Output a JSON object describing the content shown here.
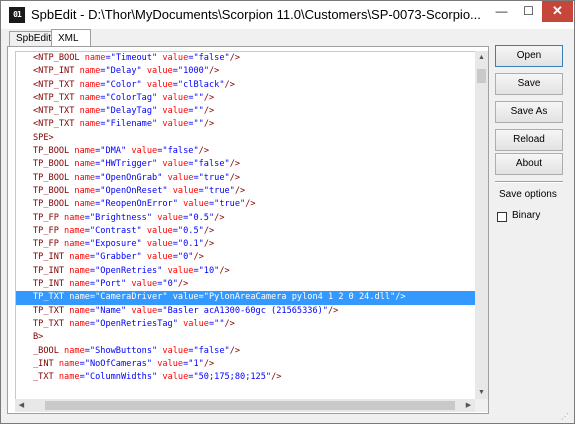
{
  "window": {
    "title": "SpbEdit - D:\\Thor\\MyDocuments\\Scorpion 11.0\\Customers\\SP-0073-Scorpio...",
    "icon_text": "01",
    "minimize_glyph": "—",
    "maximize_glyph": "☐",
    "close_glyph": "✕"
  },
  "tabs": [
    "SpbEdit",
    "XML"
  ],
  "editor": {
    "selected_line": 20,
    "lines": [
      {
        "tag": "<NTP_BOOL",
        "name": "Timeout",
        "value": "false",
        "end": "/>"
      },
      {
        "tag": "<NTP_INT",
        "name": "Delay",
        "value": "1000",
        "end": "/>"
      },
      {
        "tag": "<NTP_TXT",
        "name": "Color",
        "value": "clBlack",
        "end": "/>"
      },
      {
        "tag": "<NTP_TXT",
        "name": "ColorTag",
        "value": "",
        "end": "/>"
      },
      {
        "tag": "<NTP_TXT",
        "name": "DelayTag",
        "value": "",
        "end": "/>"
      },
      {
        "tag": "<NTP_TXT",
        "name": "Filename",
        "value": "",
        "end": "/>"
      },
      {
        "tag": "SPE>",
        "name": null,
        "value": null,
        "end": ""
      },
      {
        "tag": "TP_BOOL",
        "name": "DMA",
        "value": "false",
        "end": "/>"
      },
      {
        "tag": "TP_BOOL",
        "name": "HWTrigger",
        "value": "false",
        "end": "/>"
      },
      {
        "tag": "TP_BOOL",
        "name": "OpenOnGrab",
        "value": "true",
        "end": "/>"
      },
      {
        "tag": "TP_BOOL",
        "name": "OpenOnReset",
        "value": "true",
        "end": "/>"
      },
      {
        "tag": "TP_BOOL",
        "name": "ReopenOnError",
        "value": "true",
        "end": "/>"
      },
      {
        "tag": "TP_FP",
        "name": "Brightness",
        "value": "0.5",
        "end": "/>"
      },
      {
        "tag": "TP_FP",
        "name": "Contrast",
        "value": "0.5",
        "end": "/>"
      },
      {
        "tag": "TP_FP",
        "name": "Exposure",
        "value": "0.1",
        "end": "/>"
      },
      {
        "tag": "TP_INT",
        "name": "Grabber",
        "value": "0",
        "end": "/>"
      },
      {
        "tag": "TP_INT",
        "name": "OpenRetries",
        "value": "10",
        "end": "/>"
      },
      {
        "tag": "TP_INT",
        "name": "Port",
        "value": "0",
        "end": "/>"
      },
      {
        "tag": "TP_TXT",
        "name": "CameraDriver",
        "value": "PylonAreaCamera pylon4 1 2 0 24.dll",
        "end": "/>"
      },
      {
        "tag": "TP_TXT",
        "name": "Name",
        "value": "Basler acA1300-60gc (21565336)",
        "end": "/>"
      },
      {
        "tag": "TP_TXT",
        "name": "OpenRetriesTag",
        "value": "",
        "end": "/>"
      },
      {
        "tag": "B>",
        "name": null,
        "value": null,
        "end": ""
      },
      {
        "tag": "_BOOL",
        "name": "ShowButtons",
        "value": "false",
        "end": "/>"
      },
      {
        "tag": "_INT",
        "name": "NoOfCameras",
        "value": "1",
        "end": "/>"
      },
      {
        "tag": "_TXT",
        "name": "ColumnWidths",
        "value": "50;175;80;125",
        "end": "/>"
      }
    ]
  },
  "buttons": {
    "open": "Open",
    "save": "Save",
    "save_as": "Save As",
    "reload": "Reload",
    "about": "About"
  },
  "save_options": {
    "label": "Save options",
    "binary_label": "Binary",
    "binary_checked": false
  },
  "scrollbar_glyphs": {
    "up": "▲",
    "down": "▼",
    "left": "◀",
    "right": "▶"
  }
}
